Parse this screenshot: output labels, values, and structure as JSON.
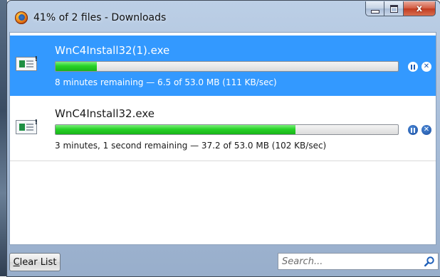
{
  "window": {
    "title": "41% of 2 files - Downloads",
    "controls": {
      "minimize": "–",
      "maximize": "□",
      "close": "x"
    }
  },
  "downloads": [
    {
      "filename": "WnC4Install32(1).exe",
      "progress_percent": 12,
      "status": "8 minutes remaining — 6.5 of 53.0 MB (111 KB/sec)",
      "selected": true
    },
    {
      "filename": "WnC4Install32.exe",
      "progress_percent": 70,
      "status": "3 minutes, 1 second remaining — 37.2 of 53.0 MB (102 KB/sec)",
      "selected": false
    }
  ],
  "footer": {
    "clear_button_accel": "C",
    "clear_button_rest": "lear List",
    "search_placeholder": "Search..."
  },
  "colors": {
    "selection": "#3399ff",
    "progress_green": "#28d228"
  },
  "icons": {
    "app": "firefox-icon",
    "file": "executable-file-icon",
    "pause": "pause-icon",
    "cancel": "cancel-icon",
    "search": "search-icon"
  }
}
